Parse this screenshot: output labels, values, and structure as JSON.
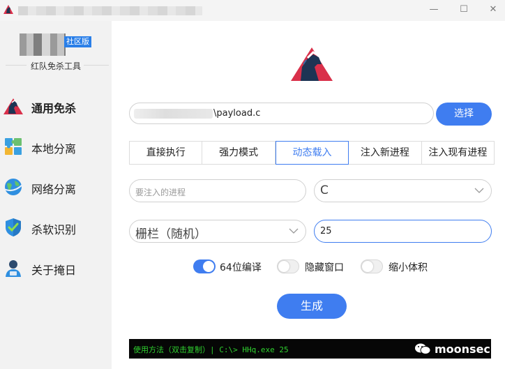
{
  "window": {
    "min_glyph": "—",
    "max_glyph": "☐",
    "close_glyph": "✕"
  },
  "sidebar": {
    "edition_badge": "社区版",
    "subtitle": "红队免杀工具",
    "items": [
      {
        "label": "通用免杀",
        "icon": "horse-logo-icon",
        "active": true
      },
      {
        "label": "本地分离",
        "icon": "puzzle-icon",
        "active": false
      },
      {
        "label": "网络分离",
        "icon": "globe-icon",
        "active": false
      },
      {
        "label": "杀软识别",
        "icon": "shield-icon",
        "active": false
      },
      {
        "label": "关于掩日",
        "icon": "user-icon",
        "active": false
      }
    ]
  },
  "main": {
    "file_path_suffix": "\\payload.c",
    "select_button": "选择",
    "tabs": [
      {
        "label": "直接执行",
        "active": false
      },
      {
        "label": "强力模式",
        "active": false
      },
      {
        "label": "动态载入",
        "active": true
      },
      {
        "label": "注入新进程",
        "active": false
      },
      {
        "label": "注入现有进程",
        "active": false
      }
    ],
    "process_placeholder": "要注入的进程",
    "language_select": "C",
    "encoding_select": "栅栏（随机）",
    "key_value": "25",
    "toggles": [
      {
        "label": "64位编译",
        "on": true
      },
      {
        "label": "隐藏窗口",
        "on": false
      },
      {
        "label": "缩小体积",
        "on": false
      }
    ],
    "generate_button": "生成"
  },
  "console": {
    "text": "使用方法（双击复制）| C:\\> HHq.exe 25"
  },
  "watermark": {
    "text": "moonsec"
  },
  "colors": {
    "accent": "#3f7df0",
    "console_text": "#2fd02f",
    "sidebar_bg": "#f2f2f2"
  }
}
